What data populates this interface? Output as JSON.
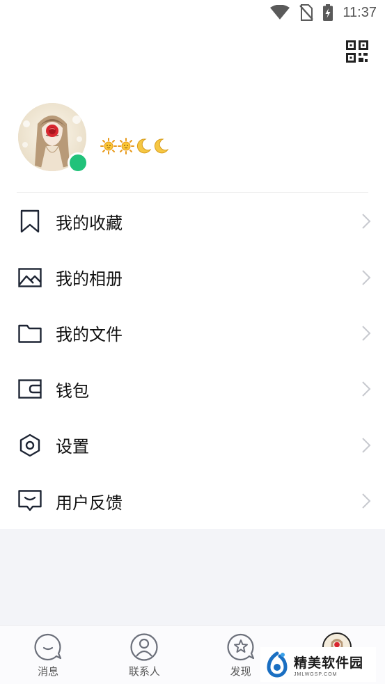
{
  "status_bar": {
    "time": "11:37",
    "icons": [
      "wifi-icon",
      "no-sim-icon",
      "battery-charging-icon"
    ]
  },
  "header": {
    "qr_icon": "qr-code-icon"
  },
  "profile": {
    "online_status_color": "#21c27a",
    "status_badges": [
      "sun-icon",
      "sun-icon",
      "moon-icon",
      "moon-icon"
    ]
  },
  "menu": {
    "items": [
      {
        "label": "我的收藏",
        "icon": "bookmark-icon"
      },
      {
        "label": "我的相册",
        "icon": "image-icon"
      },
      {
        "label": "我的文件",
        "icon": "folder-icon"
      },
      {
        "label": "钱包",
        "icon": "wallet-icon"
      },
      {
        "label": "设置",
        "icon": "settings-hexagon-icon"
      },
      {
        "label": "用户反馈",
        "icon": "feedback-icon"
      }
    ]
  },
  "tabbar": {
    "tabs": [
      {
        "label": "消息",
        "icon": "message-bubble-icon"
      },
      {
        "label": "联系人",
        "icon": "person-icon"
      },
      {
        "label": "发现",
        "icon": "star-bubble-icon"
      },
      {
        "label": "",
        "icon": "avatar"
      }
    ]
  },
  "watermark": {
    "name": "精美软件园",
    "url": "JMLWGSP.COM"
  }
}
